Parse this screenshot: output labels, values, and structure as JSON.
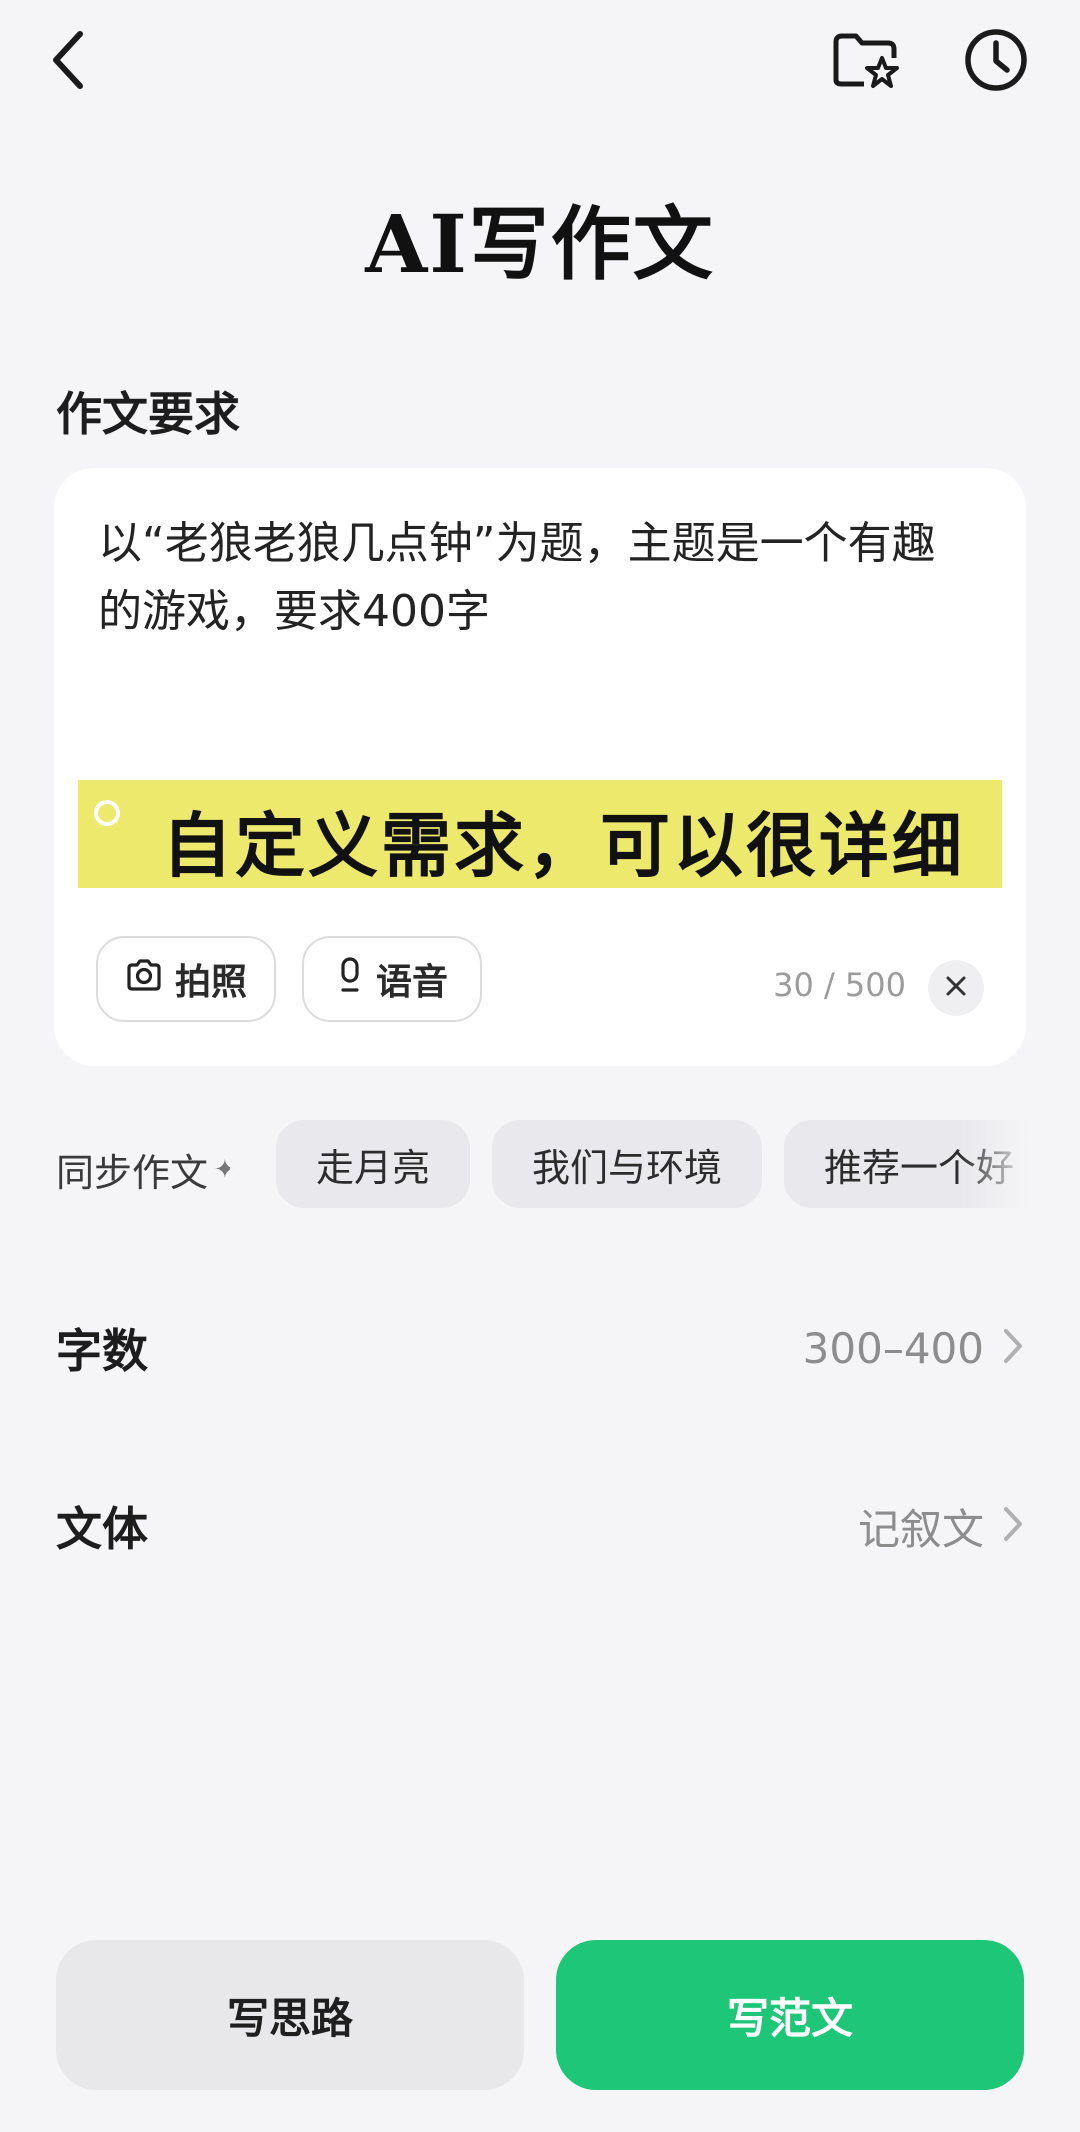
{
  "header": {
    "title": "AI写作文"
  },
  "requirements": {
    "section_label": "作文要求",
    "text": "以“老狼老狼几点钟”为题，主题是一个有趣的游戏，要求400字",
    "photo_label": "拍照",
    "voice_label": "语音",
    "char_count": "30 / 500"
  },
  "banner": {
    "text": "自定义需求，可以很详细",
    "color": "#ece96c"
  },
  "sync": {
    "label": "同步作文",
    "chips": [
      "走月亮",
      "我们与环境",
      "推荐一个好"
    ]
  },
  "settings": {
    "word_count_label": "字数",
    "word_count_value": "300–400",
    "style_label": "文体",
    "style_value": "记叙文"
  },
  "actions": {
    "outline_label": "写思路",
    "sample_label": "写范文",
    "accent_color": "#1ec678"
  },
  "icons": {
    "back": "chevron-left-icon",
    "folder": "folder-star-icon",
    "history": "clock-icon",
    "camera": "camera-icon",
    "mic": "mic-icon",
    "clear": "close-icon",
    "chevron": "chevron-right-icon"
  }
}
